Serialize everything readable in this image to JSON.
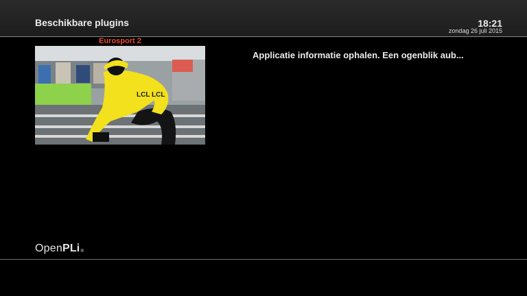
{
  "header": {
    "title": "Beschikbare plugins",
    "time": "18:21",
    "date": "zondag 26 juli 2015"
  },
  "preview": {
    "channel_name": "Eurosport 2",
    "overlay_text": "LCL LCL",
    "channel_color": "#e8492a"
  },
  "main": {
    "status_message": "Applicatie informatie ophalen. Een ogenblik aub..."
  },
  "footer": {
    "logo_text_light": "Open",
    "logo_text_bold": "PLi",
    "logo_mark": "®"
  }
}
